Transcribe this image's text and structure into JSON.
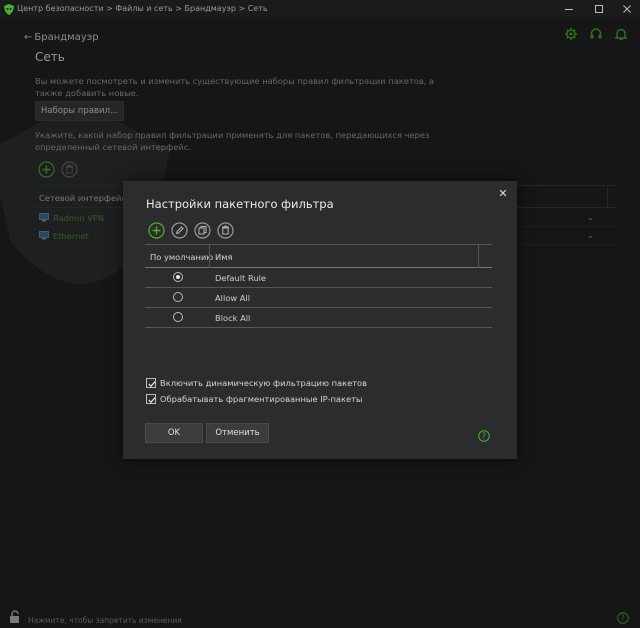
{
  "window": {
    "title": "Центр безопасности > Файлы и сеть > Брандмауэр > Сеть",
    "icons": [
      "shield-app-icon",
      "minimize-icon",
      "maximize-icon",
      "close-icon"
    ]
  },
  "header": {
    "back_label": "Брандмауэр",
    "page_title": "Сеть",
    "icons": [
      "gear-icon",
      "headset-icon",
      "bell-icon"
    ]
  },
  "page": {
    "description1": "Вы можете посмотреть и изменить существующие наборы правил фильтрации пакетов, а также добавить новые.",
    "rules_button": "Наборы правил...",
    "description2": "Укажите, какой набор правил фильтрации применять для пакетов, передающихся через определенный сетевой интерфейс.",
    "interface_column": "Сетевой интерфейс",
    "interfaces": [
      {
        "name": "Radmin VPN",
        "icon": "network-icon"
      },
      {
        "name": "Ethernet",
        "icon": "network-icon"
      }
    ],
    "status_text": "Нажмите, чтобы запретить изменения"
  },
  "dialog": {
    "title": "Настройки пакетного фильтра",
    "close_symbol": "✕",
    "tools": [
      "add-icon",
      "edit-icon",
      "copy-icon",
      "delete-icon"
    ],
    "columns": {
      "default": "По умолчанию",
      "name": "Имя"
    },
    "rules": [
      {
        "name": "Default Rule",
        "selected": true
      },
      {
        "name": "Allow All",
        "selected": false
      },
      {
        "name": "Block All",
        "selected": false
      }
    ],
    "options": [
      {
        "label": "Включить динамическую фильтрацию пакетов",
        "checked": true
      },
      {
        "label": "Обрабатывать фрагментированные IP-пакеты",
        "checked": true
      }
    ],
    "ok_label": "OK",
    "cancel_label": "Отменить"
  },
  "colors": {
    "accent": "#4caf2e",
    "link_green": "#4d8f3b",
    "background": "#222324",
    "dialog": "#2b2c2d"
  }
}
